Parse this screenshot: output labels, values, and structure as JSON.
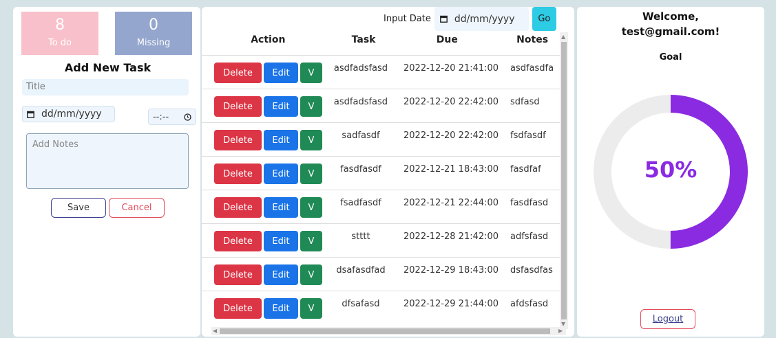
{
  "stats": {
    "todo": {
      "count": "8",
      "label": "To do"
    },
    "missing": {
      "count": "0",
      "label": "Missing"
    }
  },
  "form": {
    "heading": "Add New Task",
    "title_placeholder": "Title",
    "date_placeholder": "dd/mm/yyyy",
    "time_placeholder": "--:--",
    "notes_placeholder": "Add Notes",
    "save_label": "Save",
    "cancel_label": "Cancel"
  },
  "filter": {
    "label": "Input Date",
    "date_placeholder": "dd/mm/yyyy",
    "go_label": "Go"
  },
  "table": {
    "headers": {
      "action": "Action",
      "task": "Task",
      "due": "Due",
      "notes": "Notes"
    },
    "button_labels": {
      "delete": "Delete",
      "edit": "Edit",
      "view": "V"
    },
    "rows": [
      {
        "task": "asdfadsfasd",
        "due": "2022-12-20 21:41:00",
        "notes": "asdfasdfa"
      },
      {
        "task": "asdfadsfasd",
        "due": "2022-12-20 22:42:00",
        "notes": "sdfasd"
      },
      {
        "task": "sadfasdf",
        "due": "2022-12-20 22:42:00",
        "notes": "fsdfasdf"
      },
      {
        "task": "fasdfasdf",
        "due": "2022-12-21 18:43:00",
        "notes": "fasdfaf"
      },
      {
        "task": "fsadfasdf",
        "due": "2022-12-21 22:44:00",
        "notes": "fasdfasd"
      },
      {
        "task": "stttt",
        "due": "2022-12-28 21:42:00",
        "notes": "adfsfasd"
      },
      {
        "task": "dsafasdfad",
        "due": "2022-12-29 18:43:00",
        "notes": "dsfasdfas"
      },
      {
        "task": "dfsafasd",
        "due": "2022-12-29 21:44:00",
        "notes": "afdsfasd"
      }
    ]
  },
  "profile": {
    "welcome_line1": "Welcome,",
    "email": "test@gmail.com!",
    "goal_label": "Goal",
    "goal_percent": "50%",
    "goal_fraction": 0.5,
    "logout_label": "Logout"
  },
  "colors": {
    "todo_bg": "#f8c0ca",
    "missing_bg": "#94a6cd",
    "delete": "#dc3545",
    "edit": "#1a74e8",
    "view": "#1f8a55",
    "go": "#2dcbe4",
    "gauge": "#8a2be2"
  }
}
